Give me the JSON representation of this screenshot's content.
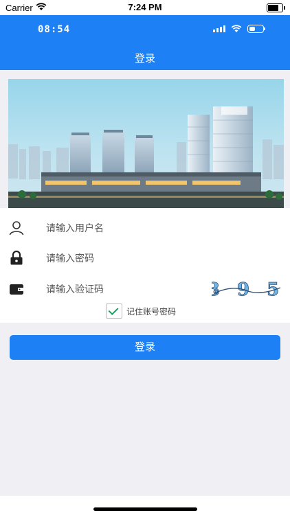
{
  "status_bar": {
    "carrier": "Carrier",
    "time": "7:24 PM"
  },
  "app_header": {
    "inner_time": "08:54",
    "title": "登录"
  },
  "form": {
    "username_placeholder": "请输入用户名",
    "password_placeholder": "请输入密码",
    "captcha_placeholder": "请输入验证码",
    "captcha_text": "3 9 5",
    "remember_label": "记住账号密码",
    "remember_checked": true
  },
  "login_button": {
    "label": "登录"
  },
  "colors": {
    "primary": "#1d80f4",
    "check": "#11a562",
    "background": "#efeff4"
  }
}
